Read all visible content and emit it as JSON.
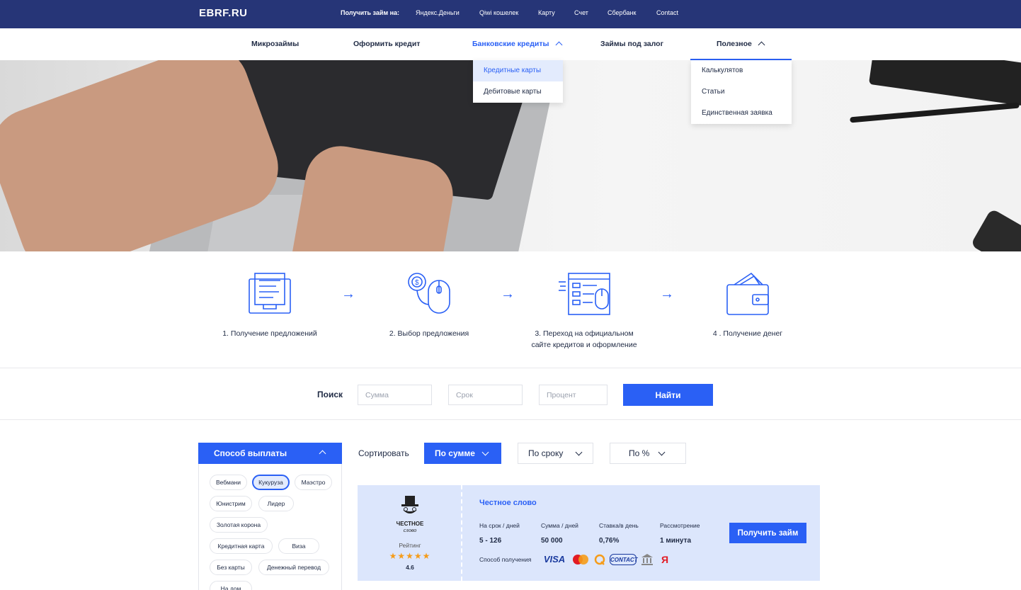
{
  "header": {
    "logo": "EBRF.RU",
    "get_loan_label": "Получить займ на:",
    "links": [
      "Яндекс.Деньги",
      "Qiwi кошелек",
      "Карту",
      "Счет",
      "Сбербанк",
      "Contact"
    ]
  },
  "nav": {
    "items": [
      "Микрозаймы",
      "Оформить кредит",
      "Банковские кредиты",
      "Займы под залог",
      "Полезное"
    ],
    "active": "Банковские кредиты",
    "dropdown_bank": [
      "Кредитные карты",
      "Дебитовые карты"
    ],
    "dropdown_bank_selected": "Кредитные карты",
    "dropdown_useful": [
      "Калькулятов",
      "Статьи",
      "Единственная заявка"
    ]
  },
  "steps": [
    {
      "icon": "laptop-document-icon",
      "line1": "1. Получение предложений",
      "line2": ""
    },
    {
      "icon": "coin-mouse-icon",
      "line1": "2. Выбор предложения",
      "line2": ""
    },
    {
      "icon": "browser-form-icon",
      "line1": "3. Переход на официальном",
      "line2": "сайте кредитов и оформление"
    },
    {
      "icon": "wallet-money-icon",
      "line1": "4 . Получение денег",
      "line2": ""
    }
  ],
  "search": {
    "label": "Поиск",
    "sum_placeholder": "Сумма",
    "term_placeholder": "Срок",
    "percent_placeholder": "Процент",
    "button": "Найти"
  },
  "filter": {
    "title": "Способ выплаты",
    "chips": [
      "Вебмани",
      "Кукуруза",
      "Маэстро",
      "Юнистрим",
      "Лидер",
      "Золотая корона",
      "Кредитная карта",
      "Виза",
      "Без карты",
      "Денежный перевод",
      "На дом"
    ],
    "selected": "Кукуруза"
  },
  "sort": {
    "label": "Сортировать",
    "options": [
      "По сумме",
      "По сроку",
      "По %"
    ],
    "active": "По сумме"
  },
  "offer": {
    "brand_line1": "ЧЕСТНОЕ",
    "brand_line2": "слово",
    "rating_label": "Рейтинг",
    "stars": "★★★★★",
    "rating": "4.6",
    "title": "Честное слово",
    "term_label": "На срок / дней",
    "term_value": "5 - 126",
    "sum_label": "Сумма / дней",
    "sum_value": "50 000",
    "rate_label": "Ставка/в день",
    "rate_value": "0,76%",
    "review_label": "Рассмотрение",
    "review_value": "1 минута",
    "payment_label": "Способ получения",
    "payment_methods": [
      "VISA",
      "MasterCard",
      "Qiwi",
      "CONTACT",
      "bank-icon",
      "Я"
    ],
    "button": "Получить займ"
  },
  "colors": {
    "accent": "#2a60f5",
    "header": "#263577",
    "card": "#dce6fc",
    "star": "#f59c1a"
  }
}
